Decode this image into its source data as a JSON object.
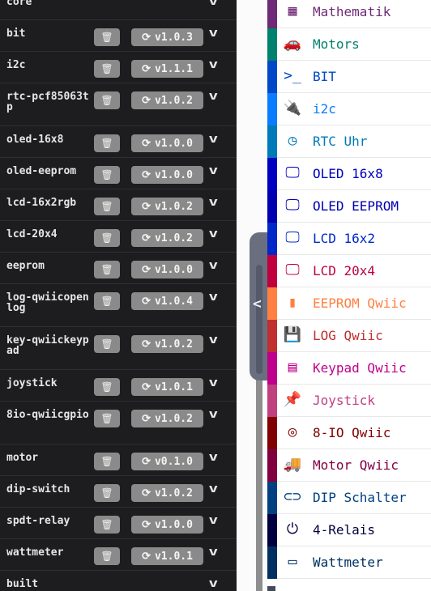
{
  "extensions": [
    {
      "name": "core",
      "tall": false,
      "controls": false
    },
    {
      "name": "bit",
      "version": "v1.0.3",
      "controls": true
    },
    {
      "name": "i2c",
      "version": "v1.1.1",
      "controls": true
    },
    {
      "name": "rtc-pcf85063tp",
      "version": "v1.0.2",
      "controls": true,
      "tall": true
    },
    {
      "name": "oled-16x8",
      "version": "v1.0.0",
      "controls": true
    },
    {
      "name": "oled-eeprom",
      "version": "v1.0.0",
      "controls": true
    },
    {
      "name": "lcd-16x2rgb",
      "version": "v1.0.2",
      "controls": true
    },
    {
      "name": "lcd-20x4",
      "version": "v1.0.2",
      "controls": true
    },
    {
      "name": "eeprom",
      "version": "v1.0.0",
      "controls": true
    },
    {
      "name": "log-qwiicopenlog",
      "version": "v1.0.4",
      "controls": true,
      "tall": true
    },
    {
      "name": "key-qwiickeypad",
      "version": "v1.0.2",
      "controls": true,
      "tall": true
    },
    {
      "name": "joystick",
      "version": "v1.0.1",
      "controls": true
    },
    {
      "name": "8io-qwiicgpio",
      "version": "v1.0.2",
      "controls": true,
      "tall": true
    },
    {
      "name": "motor",
      "version": "v0.1.0",
      "controls": true
    },
    {
      "name": "dip-switch",
      "version": "v1.0.2",
      "controls": true
    },
    {
      "name": "spdt-relay",
      "version": "v1.0.0",
      "controls": true
    },
    {
      "name": "wattmeter",
      "version": "v1.0.1",
      "controls": true
    },
    {
      "name": "built",
      "controls": false
    }
  ],
  "icons": {
    "delete": "trash-icon",
    "update": "refresh-icon",
    "expand": "chevron-down-icon",
    "collapse": "chevron-left-icon"
  },
  "categories": [
    {
      "label": "Mathematik",
      "color": "#6e2a76",
      "icon": "calculator-icon",
      "glyph": "▦"
    },
    {
      "label": "Motors",
      "color": "#00806e",
      "icon": "car-icon",
      "glyph": "🚗"
    },
    {
      "label": "BIT",
      "color": "#0048c8",
      "icon": "terminal-icon",
      "glyph": ">_"
    },
    {
      "label": "i2c",
      "color": "#0a7cff",
      "icon": "plug-icon",
      "glyph": "🔌"
    },
    {
      "label": "RTC Uhr",
      "color": "#0079b8",
      "icon": "clock-icon",
      "glyph": "◷"
    },
    {
      "label": "OLED 16x8",
      "color": "#0000c0",
      "icon": "desktop-icon",
      "glyph": "🖵"
    },
    {
      "label": "OLED EEPROM",
      "color": "#0000b0",
      "icon": "desktop-icon",
      "glyph": "🖵"
    },
    {
      "label": "LCD 16x2",
      "color": "#0028c8",
      "icon": "monitor-icon",
      "glyph": "🖵"
    },
    {
      "label": "LCD 20x4",
      "color": "#c0003c",
      "icon": "monitor-icon",
      "glyph": "🖵"
    },
    {
      "label": "EEPROM Qwiic",
      "color": "#ff8040",
      "icon": "chip-icon",
      "glyph": "▮"
    },
    {
      "label": "LOG Qwiic",
      "color": "#c03030",
      "icon": "save-icon",
      "glyph": "💾"
    },
    {
      "label": "Keypad Qwiic",
      "color": "#c0008a",
      "icon": "fax-icon",
      "glyph": "▤"
    },
    {
      "label": "Joystick",
      "color": "#c04080",
      "icon": "pushpin-icon",
      "glyph": "📌"
    },
    {
      "label": "8-IO Qwiic",
      "color": "#800000",
      "icon": "bullseye-icon",
      "glyph": "◎"
    },
    {
      "label": "Motor Qwiic",
      "color": "#800040",
      "icon": "truck-icon",
      "glyph": "🚚"
    },
    {
      "label": "DIP Schalter",
      "color": "#004080",
      "icon": "toggle-icon",
      "glyph": "⊂⊃"
    },
    {
      "label": "4-Relais",
      "color": "#000040",
      "icon": "power-icon",
      "glyph": "⏻"
    },
    {
      "label": "Wattmeter",
      "color": "#003060",
      "icon": "battery-icon",
      "glyph": "▭"
    }
  ]
}
